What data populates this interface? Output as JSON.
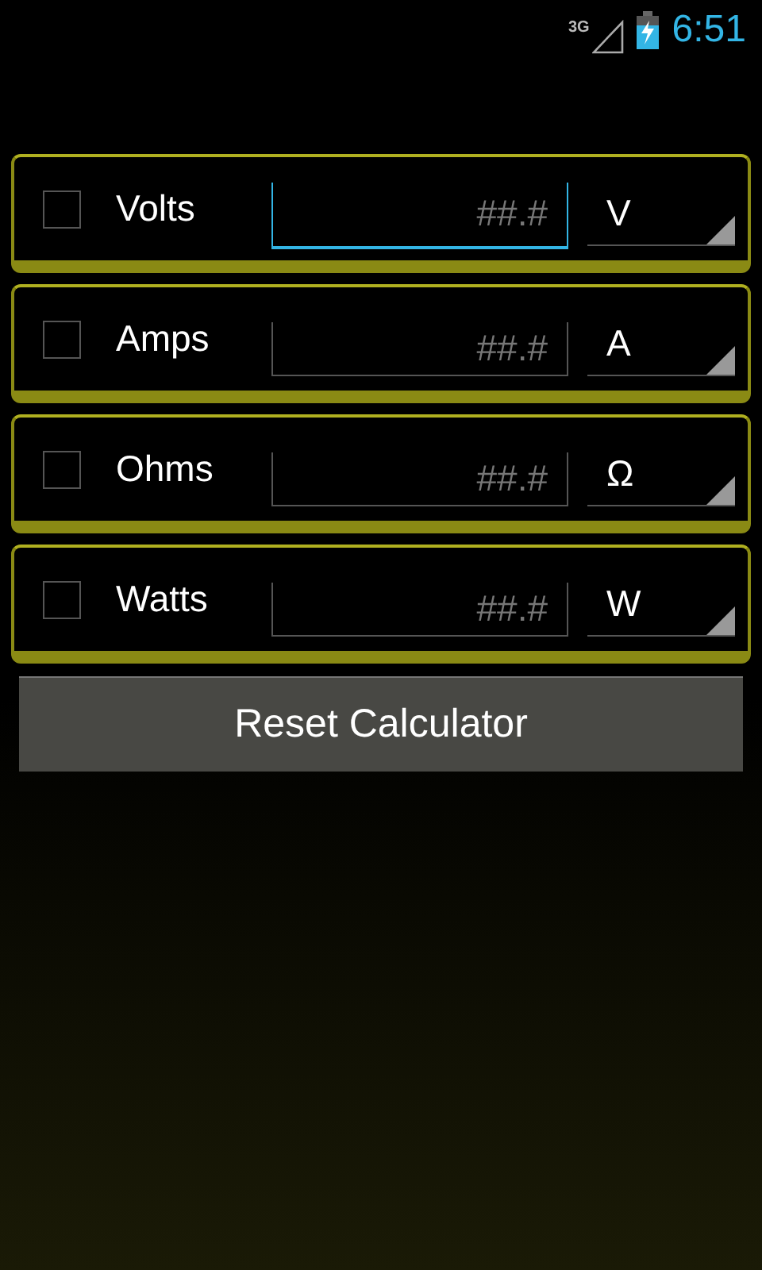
{
  "status_bar": {
    "network": "3G",
    "time": "6:51"
  },
  "rows": [
    {
      "label": "Volts",
      "checked": false,
      "placeholder": "##.#",
      "focused": true,
      "unit": "V"
    },
    {
      "label": "Amps",
      "checked": false,
      "placeholder": "##.#",
      "focused": false,
      "unit": "A"
    },
    {
      "label": "Ohms",
      "checked": false,
      "placeholder": "##.#",
      "focused": false,
      "unit": "Ω"
    },
    {
      "label": "Watts",
      "checked": false,
      "placeholder": "##.#",
      "focused": false,
      "unit": "W"
    }
  ],
  "reset_button": "Reset Calculator"
}
